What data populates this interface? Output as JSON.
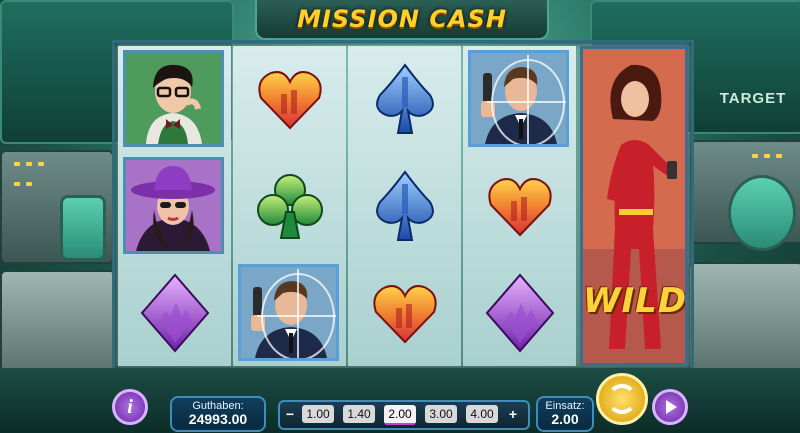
{
  "game": {
    "title": "MISSION CASH"
  },
  "background": {
    "target_sign": "TARGET"
  },
  "reels": {
    "columns": [
      [
        "character-geek-glasses",
        "character-lady-purple-hat",
        "diamond-symbol"
      ],
      [
        "heart-symbol",
        "club-symbol",
        "character-agent-gun"
      ],
      [
        "spade-symbol",
        "spade-symbol",
        "heart-symbol"
      ],
      [
        "character-agent-gun",
        "heart-symbol",
        "diamond-symbol"
      ],
      [
        "wild-expanded"
      ]
    ],
    "wild_label": "WILD"
  },
  "balance": {
    "label": "Guthaben:",
    "value": "24993.00"
  },
  "bet_levels": {
    "options": [
      "1.00",
      "1.40",
      "2.00",
      "3.00",
      "4.00"
    ],
    "selected": "2.00",
    "minus": "−",
    "plus": "+"
  },
  "stake": {
    "label": "Einsatz:",
    "value": "2.00"
  },
  "colors": {
    "heart": "#e8453a",
    "club": "#3aa64a",
    "spade": "#2f6fd0",
    "diamond": "#8e3ac8",
    "accent_gold": "#ffcf2e"
  },
  "buttons": {
    "info_icon": "i"
  }
}
